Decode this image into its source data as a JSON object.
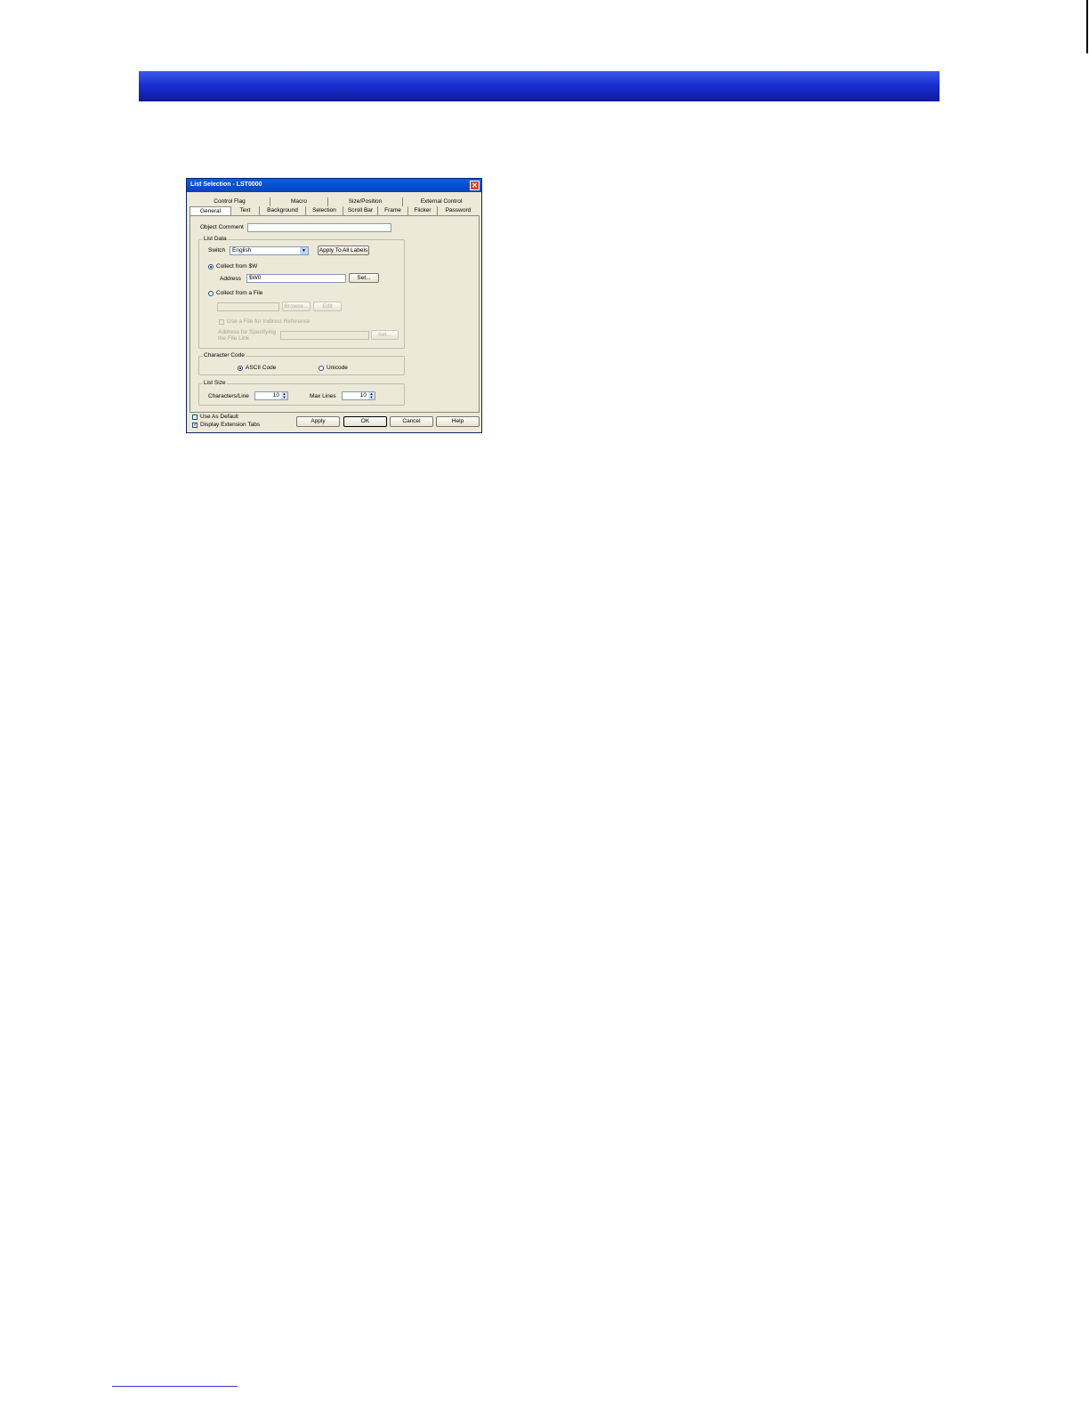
{
  "dialog": {
    "title": "List Selection - LST0000",
    "tabs_back": [
      "Control Flag",
      "Macro",
      "Size/Position",
      "External Control"
    ],
    "tabs_front": [
      "General",
      "Text",
      "Background",
      "Selection",
      "Scroll Bar",
      "Frame",
      "Flicker",
      "Password"
    ],
    "selected_tab": "General",
    "object_comment_label": "Object Comment",
    "object_comment_value": "",
    "list_data": {
      "title": "List Data",
      "switch_label": "Switch",
      "switch_value": "English",
      "apply_all_button": "Apply To All Labels",
      "collect_from_w_label": "Collect from $W",
      "address_label": "Address",
      "address_value": "$W0",
      "set_button": "Set...",
      "collect_from_file_label": "Collect from a File",
      "file_path_value": "",
      "browse_button": "Browse...",
      "edit_button": "Edit",
      "indirect_label": "Use a File for Indirect Reference",
      "address_spec_label_1": "Address for Specifying",
      "address_spec_label_2": "the File Link",
      "address_spec_value": "",
      "set2_button": "Set..."
    },
    "character_code": {
      "title": "Character Code",
      "ascii_label": "ASCII Code",
      "unicode_label": "Unicode",
      "selected": "ASCII Code"
    },
    "list_size": {
      "title": "List Size",
      "chars_per_line_label": "Characters/Line",
      "chars_per_line_value": "10",
      "max_lines_label": "Max Lines",
      "max_lines_value": "10"
    },
    "footer": {
      "use_default_label": "Use As Default",
      "use_default_checked": false,
      "display_ext_label": "Display Extension Tabs",
      "display_ext_checked": true,
      "apply_button": "Apply",
      "ok_button": "OK",
      "cancel_button": "Cancel",
      "help_button": "Help"
    }
  },
  "colors": {
    "header_bar": "#1a2fd0",
    "dialog_face": "#ece9d8",
    "titlebar": "#0a5fe6"
  }
}
